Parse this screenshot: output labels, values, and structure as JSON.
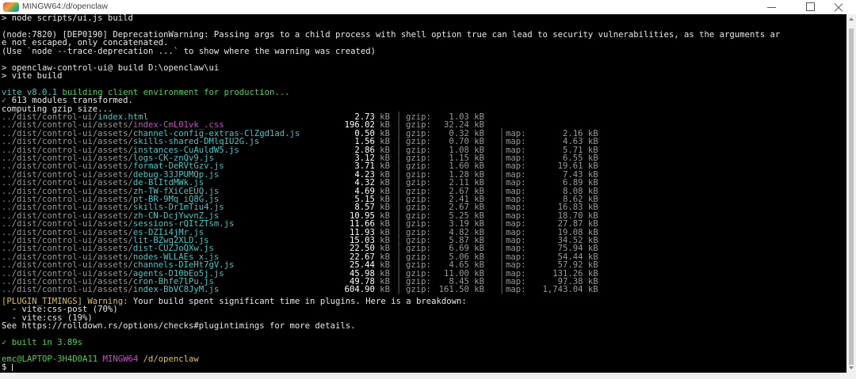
{
  "window": {
    "title": "MINGW64:/d/openclaw",
    "controls": [
      "minimize-icon",
      "maximize-icon",
      "close-icon"
    ]
  },
  "terminal": {
    "cmd1": "> node scripts/ui.js build",
    "warn1": "(node:7820) [DEP0190] DeprecationWarning: Passing args to a child process with shell option true can lead to security vulnerabilities, as the arguments ar",
    "warn2": "e not escaped, only concatenated.",
    "warn3": "(Use `node --trace-deprecation ...` to show where the warning was created)",
    "npm1": "> openclaw-control-ui@ build D:\\openclaw\\ui",
    "npm2": "> vite build",
    "vite_name": "vite v8.0.1 ",
    "vite_rest": "building client environment for production...",
    "check": "✓",
    "modules": " 613 modules transformed.",
    "gzip_line": "computing gzip size...",
    "files": [
      {
        "dir": "../dist/control-ui/",
        "name": "index.html",
        "color": "#3fc9c9",
        "size": "2.73",
        "gzip": "1.03",
        "map": ""
      },
      {
        "dir": "../dist/control-ui/assets/",
        "name": "index-CmL01vk_.css",
        "color": "#c84fc8",
        "size": "196.02",
        "gzip": "32.24",
        "map": ""
      },
      {
        "dir": "../dist/control-ui/assets/",
        "name": "channel-config-extras-ClZgd1ad.js",
        "color": "#3fc9c9",
        "size": "0.50",
        "gzip": "0.32",
        "map": "2.16"
      },
      {
        "dir": "../dist/control-ui/assets/",
        "name": "skills-shared-DMlqIU2G.js",
        "color": "#3fc9c9",
        "size": "1.56",
        "gzip": "0.70",
        "map": "4.63"
      },
      {
        "dir": "../dist/control-ui/assets/",
        "name": "instances-CuAuldW5.js",
        "color": "#3fc9c9",
        "size": "2.86",
        "gzip": "1.08",
        "map": "5.71"
      },
      {
        "dir": "../dist/control-ui/assets/",
        "name": "logs-CK-znQv9.js",
        "color": "#3fc9c9",
        "size": "3.12",
        "gzip": "1.15",
        "map": "6.55"
      },
      {
        "dir": "../dist/control-ui/assets/",
        "name": "format-DeRVtGzv.js",
        "color": "#3fc9c9",
        "size": "3.71",
        "gzip": "1.60",
        "map": "19.61"
      },
      {
        "dir": "../dist/control-ui/assets/",
        "name": "debug-33JPUMQp.js",
        "color": "#3fc9c9",
        "size": "4.23",
        "gzip": "1.28",
        "map": "7.43"
      },
      {
        "dir": "../dist/control-ui/assets/",
        "name": "de-BlItdMWk.js",
        "color": "#3fc9c9",
        "size": "4.32",
        "gzip": "2.11",
        "map": "6.89"
      },
      {
        "dir": "../dist/control-ui/assets/",
        "name": "zh-TW-fXiCeEUQ.js",
        "color": "#3fc9c9",
        "size": "4.69",
        "gzip": "2.67",
        "map": "8.08"
      },
      {
        "dir": "../dist/control-ui/assets/",
        "name": "pt-BR-9Mq_iQ8G.js",
        "color": "#3fc9c9",
        "size": "5.15",
        "gzip": "2.41",
        "map": "8.62"
      },
      {
        "dir": "../dist/control-ui/assets/",
        "name": "skills-Dr1mTiu4.js",
        "color": "#3fc9c9",
        "size": "8.57",
        "gzip": "2.67",
        "map": "16.83"
      },
      {
        "dir": "../dist/control-ui/assets/",
        "name": "zh-CN-DcjYwvnZ.js",
        "color": "#3fc9c9",
        "size": "10.95",
        "gzip": "5.25",
        "map": "18.70"
      },
      {
        "dir": "../dist/control-ui/assets/",
        "name": "sessions-rQItZTsm.js",
        "color": "#3fc9c9",
        "size": "11.66",
        "gzip": "3.19",
        "map": "27.87"
      },
      {
        "dir": "../dist/control-ui/assets/",
        "name": "es-DZIi4jMr.js",
        "color": "#3fc9c9",
        "size": "11.93",
        "gzip": "4.82",
        "map": "19.08"
      },
      {
        "dir": "../dist/control-ui/assets/",
        "name": "lit-BZwq2XLD.js",
        "color": "#3fc9c9",
        "size": "15.03",
        "gzip": "5.87",
        "map": "34.52"
      },
      {
        "dir": "../dist/control-ui/assets/",
        "name": "dist-CUZJoQXw.js",
        "color": "#3fc9c9",
        "size": "22.50",
        "gzip": "6.69",
        "map": "75.94"
      },
      {
        "dir": "../dist/control-ui/assets/",
        "name": "nodes-WLLAEs_x.js",
        "color": "#3fc9c9",
        "size": "22.67",
        "gzip": "5.06",
        "map": "54.44"
      },
      {
        "dir": "../dist/control-ui/assets/",
        "name": "channels-DIeHt7gV.js",
        "color": "#3fc9c9",
        "size": "25.44",
        "gzip": "4.65",
        "map": "57.92"
      },
      {
        "dir": "../dist/control-ui/assets/",
        "name": "agents-D10bEo5j.js",
        "color": "#3fc9c9",
        "size": "45.98",
        "gzip": "11.00",
        "map": "131.26"
      },
      {
        "dir": "../dist/control-ui/assets/",
        "name": "cron-Bhfe7lPu.js",
        "color": "#3fc9c9",
        "size": "49.78",
        "gzip": "8.45",
        "map": "97.38"
      },
      {
        "dir": "../dist/control-ui/assets/",
        "name": "index-BbVC8JyM.js",
        "color": "#3fc9c9",
        "size": "604.90",
        "gzip": "161.50",
        "map": "1,743.04"
      }
    ],
    "kb_unit": "kB",
    "gzip_label": "gzip:",
    "map_label": "map:",
    "sep": "│",
    "plugin_tag": "[PLUGIN_TIMINGS] Warning:",
    "plugin_msg": " Your build spent significant time in plugins. Here is a breakdown:",
    "timing1": "  - vite:css-post (70%)",
    "timing2": "  - vite:css (19%)",
    "see_more": "See https://rolldown.rs/options/checks#plugintimings for more details.",
    "built": " built in 3.89s",
    "prompt_user": "emc@LAPTOP-3H4D0A11",
    "prompt_sys": " MINGW64",
    "prompt_path": " /d/openclaw",
    "prompt_symbol": "$ "
  },
  "colors": {
    "cyan": "#3fc9c9",
    "magenta": "#c84fc8",
    "green": "#4fd24f",
    "yellow": "#e0c23a",
    "purple": "#b57ad0"
  }
}
